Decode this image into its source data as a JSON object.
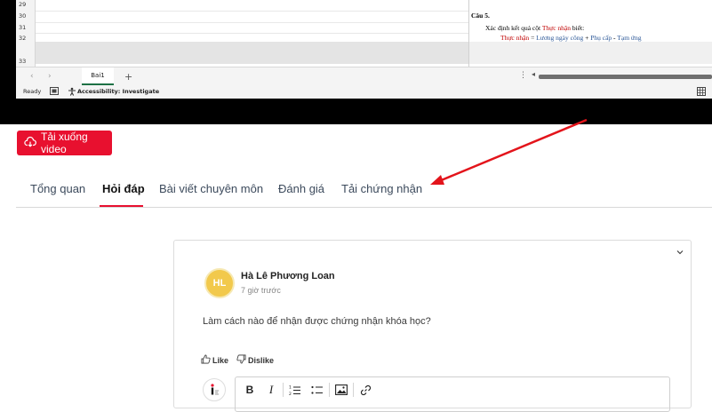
{
  "excel": {
    "rows": [
      "29",
      "30",
      "31",
      "32",
      "33"
    ],
    "document": {
      "heading": "Câu 5.",
      "line1_prefix": "Xác định kết quả cột ",
      "line1_red": "Thực nhận",
      "line1_suffix": " biết:",
      "formula_red": "Thực nhận",
      "formula_eq": " = ",
      "formula_rest_1": "Lương ngày công",
      "formula_plus_1": " + ",
      "formula_rest_2": "Phụ cấp",
      "formula_minus": " - ",
      "formula_rest_3": "Tạm ứng"
    },
    "sheet_tab": "Bai1",
    "status": {
      "ready": "Ready",
      "accessibility": "Accessibility: Investigate"
    }
  },
  "download_button": {
    "label": "Tải xuống video"
  },
  "tabs": [
    {
      "label": "Tổng quan"
    },
    {
      "label": "Hỏi đáp"
    },
    {
      "label": "Bài viết chuyên môn"
    },
    {
      "label": "Đánh giá"
    },
    {
      "label": "Tải chứng nhận"
    }
  ],
  "post": {
    "avatar_initials": "HL",
    "author": "Hà Lê Phương Loan",
    "time": "7 giờ trước",
    "question": "Làm cách nào để nhận được chứng nhận khóa học?",
    "like_label": "Like",
    "dislike_label": "Dislike"
  },
  "editor": {
    "bold": "B",
    "italic": "I"
  },
  "colors": {
    "brand_red": "#e8102f",
    "avatar_yellow": "#f2c94c",
    "annotation_arrow": "#e3141b"
  }
}
